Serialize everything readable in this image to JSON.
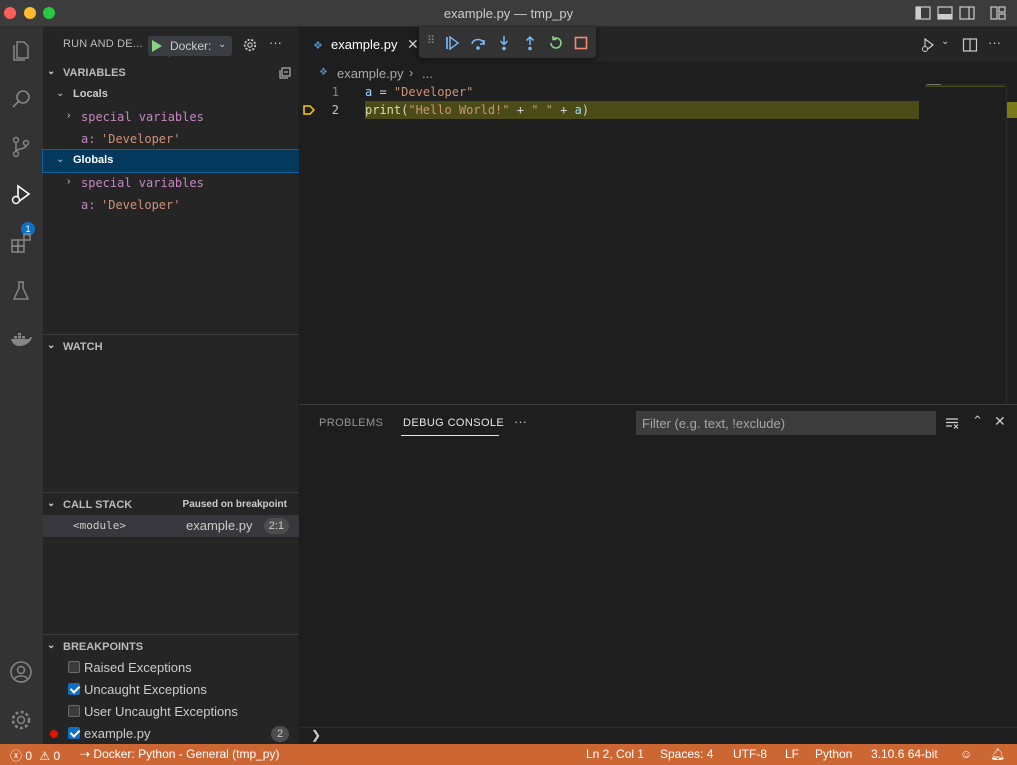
{
  "window": {
    "title": "example.py — tmp_py"
  },
  "activity_bar": {
    "items": [
      "explorer-icon",
      "search-icon",
      "source-control-icon",
      "run-debug-icon",
      "extensions-icon",
      "testing-icon",
      "docker-icon"
    ],
    "debug_badge": "1",
    "bottom": [
      "accounts-icon",
      "manage-gear-icon"
    ]
  },
  "sidebar": {
    "title": "RUN AND DE...",
    "run_config": "Docker:",
    "variables": {
      "header": "VARIABLES",
      "locals_label": "Locals",
      "globals_label": "Globals",
      "special_label": "special variables",
      "local_var_name": "a:",
      "local_var_value": "'Developer'",
      "global_var_name": "a:",
      "global_var_value": "'Developer'"
    },
    "watch": {
      "header": "WATCH"
    },
    "call_stack": {
      "header": "CALL STACK",
      "status": "Paused on breakpoint",
      "frame_name": "<module>",
      "frame_file": "example.py",
      "frame_pos": "2:1"
    },
    "breakpoints": {
      "header": "BREAKPOINTS",
      "items": [
        {
          "label": "Raised Exceptions",
          "checked": false
        },
        {
          "label": "Uncaught Exceptions",
          "checked": true
        },
        {
          "label": "User Uncaught Exceptions",
          "checked": false
        },
        {
          "label": "example.py",
          "checked": true,
          "count": "2"
        }
      ]
    }
  },
  "editor": {
    "tab_label": "example.py",
    "breadcrumb_file": "example.py",
    "breadcrumb_rest": "...",
    "lines": [
      {
        "no": "1",
        "tokens": [
          [
            "a",
            "var"
          ],
          [
            " = ",
            "op"
          ],
          [
            "\"Developer\"",
            "str"
          ]
        ]
      },
      {
        "no": "2",
        "tokens": [
          [
            "print",
            "fn"
          ],
          [
            "(",
            "op"
          ],
          [
            "\"Hello World!\"",
            "str"
          ],
          [
            " + ",
            "op"
          ],
          [
            "\" \"",
            "str"
          ],
          [
            " + ",
            "op"
          ],
          [
            "a",
            "var"
          ],
          [
            ")",
            "op"
          ]
        ]
      }
    ],
    "current_line": 2
  },
  "panel": {
    "tabs": [
      "PROBLEMS",
      "DEBUG CONSOLE"
    ],
    "active_tab": "DEBUG CONSOLE",
    "more": "···",
    "filter_placeholder": "Filter (e.g. text, !exclude)",
    "prompt": "❯"
  },
  "status_bar": {
    "errors": "0",
    "warnings": "0",
    "debug_target": "Docker: Python - General (tmp_py)",
    "cursor": "Ln 2, Col 1",
    "spaces": "Spaces: 4",
    "encoding": "UTF-8",
    "eol": "LF",
    "language": "Python",
    "interpreter": "3.10.6 64-bit",
    "color": "#cc6633"
  }
}
